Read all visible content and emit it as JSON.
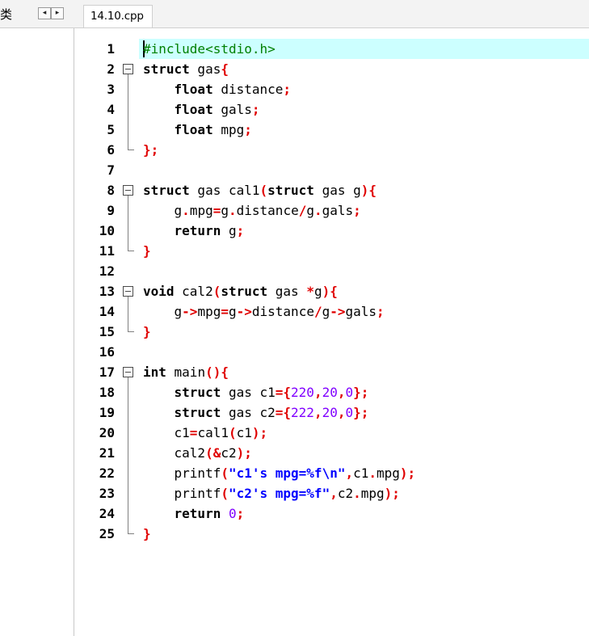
{
  "left_label": "类",
  "nav": {
    "left_glyph": "◂",
    "right_glyph": "▸"
  },
  "tab": {
    "title": "14.10.cpp"
  },
  "editor": {
    "lines": [
      {
        "n": "1",
        "seg": [
          [
            "#include<stdio.h>",
            "pp"
          ]
        ]
      },
      {
        "n": "2",
        "seg": [
          [
            "struct",
            "kw"
          ],
          [
            " gas",
            ""
          ],
          [
            "{",
            "op"
          ]
        ]
      },
      {
        "n": "3",
        "seg": [
          [
            "    ",
            ""
          ],
          [
            "float",
            "kw"
          ],
          [
            " distance",
            ""
          ],
          [
            ";",
            "op"
          ]
        ]
      },
      {
        "n": "4",
        "seg": [
          [
            "    ",
            ""
          ],
          [
            "float",
            "kw"
          ],
          [
            " gals",
            ""
          ],
          [
            ";",
            "op"
          ]
        ]
      },
      {
        "n": "5",
        "seg": [
          [
            "    ",
            ""
          ],
          [
            "float",
            "kw"
          ],
          [
            " mpg",
            ""
          ],
          [
            ";",
            "op"
          ]
        ]
      },
      {
        "n": "6",
        "seg": [
          [
            "};",
            "op"
          ]
        ]
      },
      {
        "n": "7",
        "seg": []
      },
      {
        "n": "8",
        "seg": [
          [
            "struct",
            "kw"
          ],
          [
            " gas cal1",
            ""
          ],
          [
            "(",
            "op"
          ],
          [
            "struct",
            "kw"
          ],
          [
            " gas g",
            ""
          ],
          [
            "){",
            "op"
          ]
        ]
      },
      {
        "n": "9",
        "seg": [
          [
            "    g",
            ""
          ],
          [
            ".",
            "op"
          ],
          [
            "mpg",
            ""
          ],
          [
            "=",
            "op"
          ],
          [
            "g",
            ""
          ],
          [
            ".",
            "op"
          ],
          [
            "distance",
            ""
          ],
          [
            "/",
            "op"
          ],
          [
            "g",
            ""
          ],
          [
            ".",
            "op"
          ],
          [
            "gals",
            ""
          ],
          [
            ";",
            "op"
          ]
        ]
      },
      {
        "n": "10",
        "seg": [
          [
            "    ",
            ""
          ],
          [
            "return",
            "kw"
          ],
          [
            " g",
            ""
          ],
          [
            ";",
            "op"
          ]
        ]
      },
      {
        "n": "11",
        "seg": [
          [
            "}",
            "op"
          ]
        ]
      },
      {
        "n": "12",
        "seg": []
      },
      {
        "n": "13",
        "seg": [
          [
            "void",
            "kw"
          ],
          [
            " cal2",
            ""
          ],
          [
            "(",
            "op"
          ],
          [
            "struct",
            "kw"
          ],
          [
            " gas ",
            ""
          ],
          [
            "*",
            "op"
          ],
          [
            "g",
            ""
          ],
          [
            "){",
            "op"
          ]
        ]
      },
      {
        "n": "14",
        "seg": [
          [
            "    g",
            ""
          ],
          [
            "->",
            "op"
          ],
          [
            "mpg",
            ""
          ],
          [
            "=",
            "op"
          ],
          [
            "g",
            ""
          ],
          [
            "->",
            "op"
          ],
          [
            "distance",
            ""
          ],
          [
            "/",
            "op"
          ],
          [
            "g",
            ""
          ],
          [
            "->",
            "op"
          ],
          [
            "gals",
            ""
          ],
          [
            ";",
            "op"
          ]
        ]
      },
      {
        "n": "15",
        "seg": [
          [
            "}",
            "op"
          ]
        ]
      },
      {
        "n": "16",
        "seg": []
      },
      {
        "n": "17",
        "seg": [
          [
            "int",
            "kw"
          ],
          [
            " main",
            ""
          ],
          [
            "(){",
            "op"
          ]
        ]
      },
      {
        "n": "18",
        "seg": [
          [
            "    ",
            ""
          ],
          [
            "struct",
            "kw"
          ],
          [
            " gas c1",
            ""
          ],
          [
            "={",
            "op"
          ],
          [
            "220",
            "num"
          ],
          [
            ",",
            "op"
          ],
          [
            "20",
            "num"
          ],
          [
            ",",
            "op"
          ],
          [
            "0",
            "num"
          ],
          [
            "};",
            "op"
          ]
        ]
      },
      {
        "n": "19",
        "seg": [
          [
            "    ",
            ""
          ],
          [
            "struct",
            "kw"
          ],
          [
            " gas c2",
            ""
          ],
          [
            "={",
            "op"
          ],
          [
            "222",
            "num"
          ],
          [
            ",",
            "op"
          ],
          [
            "20",
            "num"
          ],
          [
            ",",
            "op"
          ],
          [
            "0",
            "num"
          ],
          [
            "};",
            "op"
          ]
        ]
      },
      {
        "n": "20",
        "seg": [
          [
            "    c1",
            ""
          ],
          [
            "=",
            "op"
          ],
          [
            "cal1",
            ""
          ],
          [
            "(",
            "op"
          ],
          [
            "c1",
            ""
          ],
          [
            ");",
            "op"
          ]
        ]
      },
      {
        "n": "21",
        "seg": [
          [
            "    cal2",
            ""
          ],
          [
            "(&",
            "op"
          ],
          [
            "c2",
            ""
          ],
          [
            ");",
            "op"
          ]
        ]
      },
      {
        "n": "22",
        "seg": [
          [
            "    printf",
            ""
          ],
          [
            "(",
            "op"
          ],
          [
            "\"c1's mpg=%f\\n\"",
            "str"
          ],
          [
            ",",
            "op"
          ],
          [
            "c1",
            ""
          ],
          [
            ".",
            "op"
          ],
          [
            "mpg",
            ""
          ],
          [
            ");",
            "op"
          ]
        ]
      },
      {
        "n": "23",
        "seg": [
          [
            "    printf",
            ""
          ],
          [
            "(",
            "op"
          ],
          [
            "\"c2's mpg=%f\"",
            "str"
          ],
          [
            ",",
            "op"
          ],
          [
            "c2",
            ""
          ],
          [
            ".",
            "op"
          ],
          [
            "mpg",
            ""
          ],
          [
            ");",
            "op"
          ]
        ]
      },
      {
        "n": "24",
        "seg": [
          [
            "    ",
            ""
          ],
          [
            "return",
            "kw"
          ],
          [
            " ",
            ""
          ],
          [
            "0",
            "num"
          ],
          [
            ";",
            "op"
          ]
        ]
      },
      {
        "n": "25",
        "seg": [
          [
            "}",
            "op"
          ]
        ]
      }
    ],
    "folds": [
      {
        "start": "2",
        "end": "6"
      },
      {
        "start": "8",
        "end": "11"
      },
      {
        "start": "13",
        "end": "15"
      },
      {
        "start": "17",
        "end": "25"
      }
    ]
  }
}
